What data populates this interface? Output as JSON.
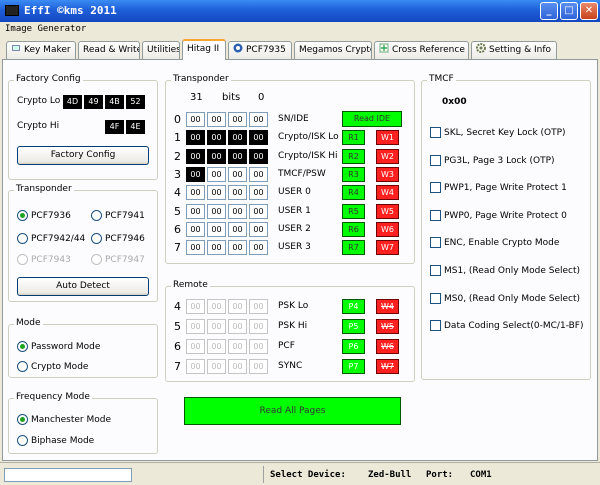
{
  "window": {
    "title": "EffI  ©kms 2011",
    "menu": "Image Generator"
  },
  "tabs": [
    "Key Maker",
    "Read & Write",
    "Utilities",
    "Hitag II",
    "PCF7935",
    "Megamos Crypto",
    "Cross Reference",
    "Setting & Info"
  ],
  "factory": {
    "title": "Factory Config",
    "lo_label": "Crypto Lo",
    "lo": [
      "4D",
      "49",
      "4B",
      "52"
    ],
    "hi_label": "Crypto Hi",
    "hi": [
      "4F",
      "4E"
    ],
    "button": "Factory Config"
  },
  "transponder_type": {
    "title": "Transponder",
    "options": [
      "PCF7936",
      "PCF7941",
      "PCF7942/44",
      "PCF7946",
      "PCF7943",
      "PCF7947"
    ],
    "button": "Auto Detect"
  },
  "mode": {
    "title": "Mode",
    "options": [
      "Password Mode",
      "Crypto Mode"
    ]
  },
  "frequency": {
    "title": "Frequency Mode",
    "options": [
      "Manchester Mode",
      "Biphase Mode"
    ]
  },
  "transponder": {
    "title": "Transponder",
    "bits_hi": "31",
    "bits_label": "bits",
    "bits_lo": "0",
    "rows": [
      {
        "page": "0",
        "label": "SN/IDE"
      },
      {
        "page": "1",
        "label": "Crypto/ISK Lo",
        "read": "R1",
        "write": "W1"
      },
      {
        "page": "2",
        "label": "Crypto/ISK Hi",
        "read": "R2",
        "write": "W2"
      },
      {
        "page": "3",
        "label": "TMCF/PSW",
        "read": "R3",
        "write": "W3"
      },
      {
        "page": "4",
        "label": "USER 0",
        "read": "R4",
        "write": "W4"
      },
      {
        "page": "5",
        "label": "USER 1",
        "read": "R5",
        "write": "W5"
      },
      {
        "page": "6",
        "label": "USER 2",
        "read": "R6",
        "write": "W6"
      },
      {
        "page": "7",
        "label": "USER 3",
        "read": "R7",
        "write": "W7"
      }
    ],
    "cell_value": "00",
    "read_ide": "Read IDE"
  },
  "remote": {
    "title": "Remote",
    "rows": [
      {
        "page": "4",
        "label": "PSK Lo",
        "read": "P4",
        "write": "W4"
      },
      {
        "page": "5",
        "label": "PSK Hi",
        "read": "P5",
        "write": "W5"
      },
      {
        "page": "6",
        "label": "PCF",
        "read": "P6",
        "write": "W6"
      },
      {
        "page": "7",
        "label": "SYNC",
        "read": "P7",
        "write": "W7"
      }
    ],
    "cell_value": "00"
  },
  "read_all": "Read All Pages",
  "tmcf": {
    "title": "TMCF",
    "value": "0x00",
    "options": [
      "SKL, Secret Key Lock (OTP)",
      "PG3L, Page 3 Lock (OTP)",
      "PWP1, Page Write Protect 1",
      "PWP0, Page Write Protect 0",
      "ENC, Enable Crypto Mode",
      "MS1, (Read Only Mode Select)",
      "MS0, (Read Only Mode Select)",
      "Data Coding Select(0-MC/1-BF)"
    ]
  },
  "status": {
    "device_label": "Select Device:",
    "device": "Zed-Bull",
    "port_label": "Port:",
    "port": "COM1"
  },
  "colors": {
    "read_green": "#00ff00",
    "write_red": "#ff2020",
    "titlebar_blue": "#1f5fd8"
  }
}
